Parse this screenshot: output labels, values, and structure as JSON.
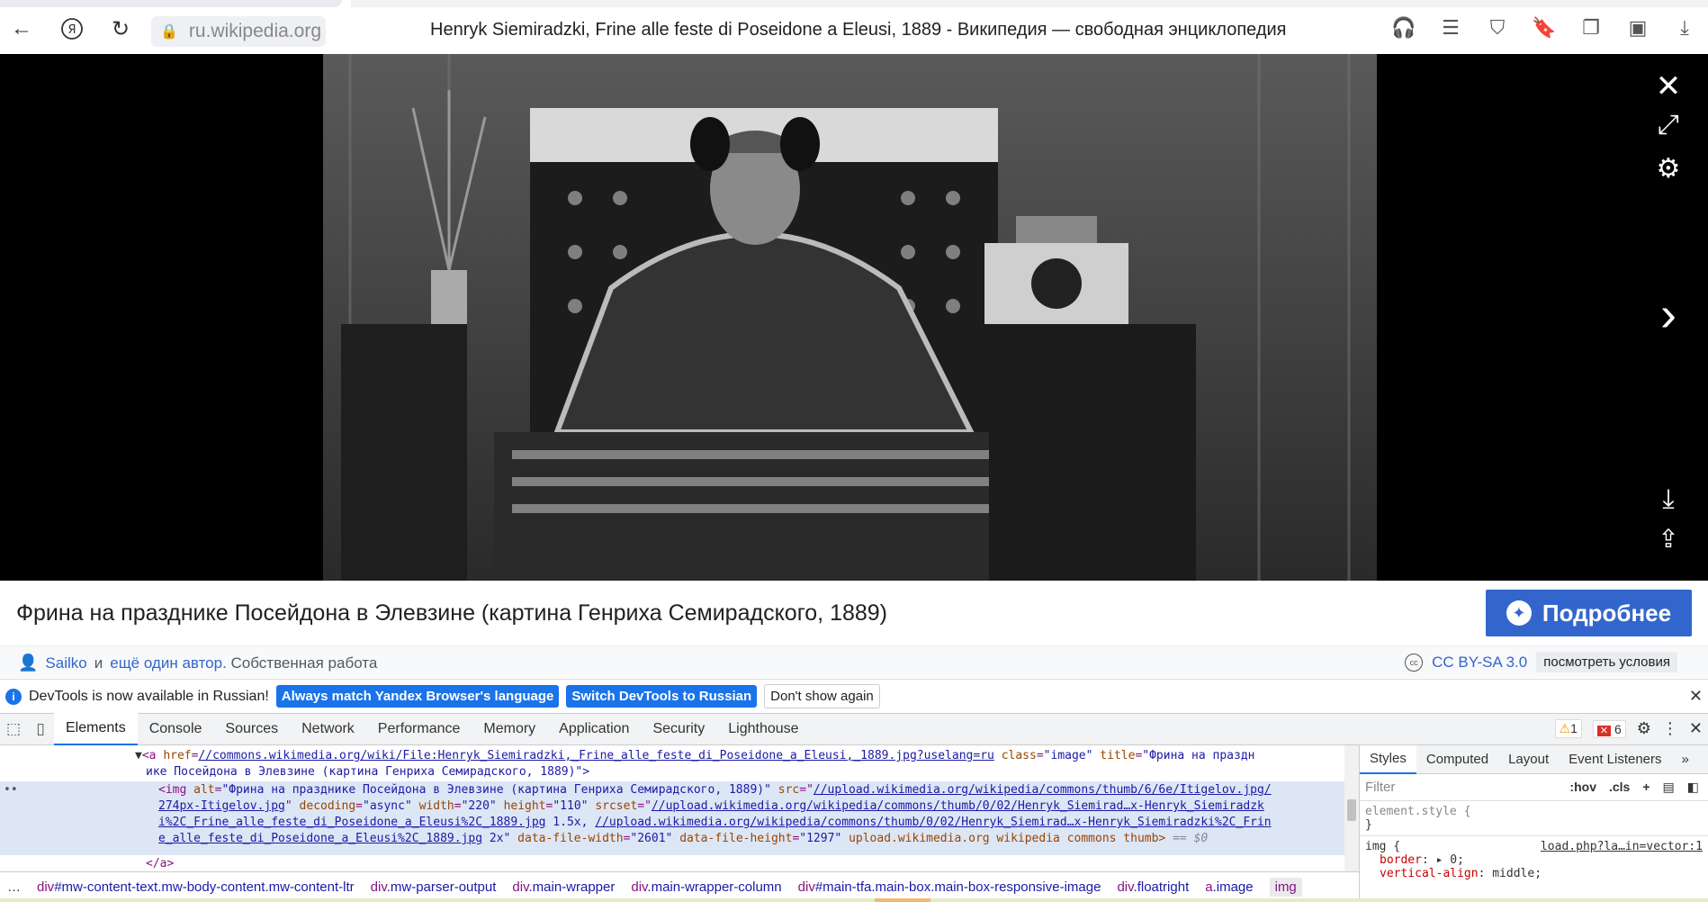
{
  "browser": {
    "url": "ru.wikipedia.org",
    "page_title": "Henryk Siemiradzki, Frine alle feste di Poseidone a Eleusi, 1889 - Википедия — свободная энциклопедия",
    "icons": [
      "back-icon",
      "yandex-icon",
      "reload-icon",
      "lock-icon",
      "headphones-icon",
      "reader-icon",
      "protect-icon",
      "bookmark-icon",
      "collections-icon",
      "extension-icon",
      "downloads-icon"
    ]
  },
  "viewer": {
    "controls": [
      "close-icon",
      "expand-icon",
      "settings-icon",
      "next-icon",
      "download-icon",
      "share-icon"
    ],
    "image_alt": "Фрина на празднике Посейдона в Элевзине (картина Генриха Семирадского, 1889)"
  },
  "caption": {
    "text": "Фрина на празднике Посейдона в Элевзине (картина Генриха Семирадского, 1889)",
    "more_button": "Подробнее"
  },
  "attribution": {
    "author_link": "Sailko",
    "and": "и",
    "more_authors": "ещё один автор",
    "work": ". Собственная работа",
    "license": "CC BY-SA 3.0",
    "terms": "посмотреть условия"
  },
  "devtools": {
    "infobar": {
      "message": "DevTools is now available in Russian!",
      "btn_match": "Always match Yandex Browser's language",
      "btn_switch": "Switch DevTools to Russian",
      "btn_dont": "Don't show again"
    },
    "tabs": [
      "Elements",
      "Console",
      "Sources",
      "Network",
      "Performance",
      "Memory",
      "Application",
      "Security",
      "Lighthouse"
    ],
    "warnings": "1",
    "errors": "6",
    "dom": {
      "a_href": "//commons.wikimedia.org/wiki/File:Henryk_Siemiradzki,_Frine_alle_feste_di_Poseidone_a_Eleusi,_1889.jpg?uselang=ru",
      "a_class": "\"image\"",
      "a_title_1": "\"Фрина на праздн",
      "a_title_2": "ике Посейдона в Элевзине (картина Генриха Семирадского, 1889)\">",
      "img_alt": "\"Фрина на празднике Посейдона в Элевзине (картина Генриха Семирадского, 1889)\"",
      "img_src_1": "//upload.wikimedia.org/wikipedia/commons/thumb/6/6e/Itigelov.jpg/",
      "img_src_2": "274px-Itigelov.jpg",
      "img_decoding": "\"async\"",
      "img_width": "\"220\"",
      "img_height": "\"110\"",
      "srcset_1": "//upload.wikimedia.org/wikipedia/commons/thumb/0/02/Henryk_Siemirad…x-Henryk_Siemiradzk",
      "srcset_2a": "i%2C_Frine_alle_feste_di_Poseidone_a_Eleusi%2C_1889.jpg",
      "srcset_2b": " 1.5x, ",
      "srcset_2c": "//upload.wikimedia.org/wikipedia/commons/thumb/0/02/Henryk_Siemirad…x-Henryk_Siemiradzki%2C_Frin",
      "srcset_3": "e_alle_feste_di_Poseidone_a_Eleusi%2C_1889.jpg",
      "srcset_3b": " 2x\"",
      "file_width": "\"2601\"",
      "file_height": "\"1297\"",
      "trailing": "upload.wikimedia.org wikipedia commons thumb>",
      "eq": "== $0",
      "close_a": "</a>"
    },
    "styles_tabs": [
      "Styles",
      "Computed",
      "Layout",
      "Event Listeners",
      "»"
    ],
    "filter_placeholder": "Filter",
    "hov": ":hov",
    "cls": ".cls",
    "element_style": "element.style {",
    "close_brace": "}",
    "img_rule": "img {",
    "img_source": "load.php?la…in=vector:1",
    "prop1": "border",
    "val1": "0;",
    "prop2": "vertical-align",
    "val2": "middle;",
    "breadcrumb": [
      {
        "tag": "div",
        "rest": "#mw-content-text.mw-body-content.mw-content-ltr"
      },
      {
        "tag": "div",
        "rest": ".mw-parser-output"
      },
      {
        "tag": "div",
        "rest": ".main-wrapper"
      },
      {
        "tag": "div",
        "rest": ".main-wrapper-column"
      },
      {
        "tag": "div",
        "rest": "#main-tfa.main-box.main-box-responsive-image"
      },
      {
        "tag": "div",
        "rest": ".floatright"
      },
      {
        "tag": "a",
        "rest": ".image"
      },
      {
        "tag": "img",
        "rest": ""
      }
    ]
  }
}
